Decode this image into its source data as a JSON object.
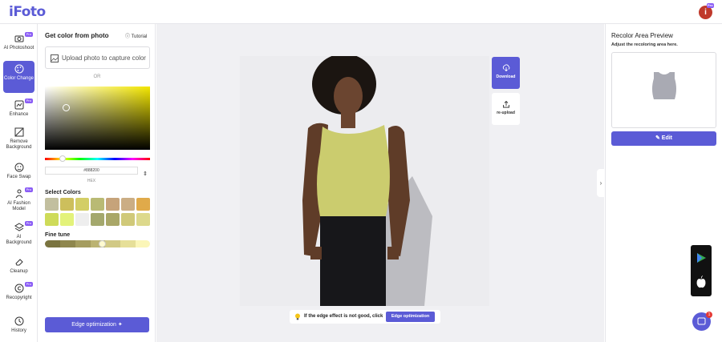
{
  "app": {
    "logo": "iFoto",
    "avatar_initial": "i",
    "avatar_badge": "Pro",
    "accent": "#5b5bd6"
  },
  "sidebar": {
    "items": [
      {
        "label": "AI Photoshoot",
        "icon": "camera-icon",
        "pro": "Pro"
      },
      {
        "label": "Color Change",
        "icon": "palette-icon",
        "active": true
      },
      {
        "label": "Enhance",
        "icon": "enhance-icon",
        "pro": "Pro"
      },
      {
        "label": "Remove Background",
        "icon": "remove-bg-icon"
      },
      {
        "label": "Face Swap",
        "icon": "face-swap-icon"
      },
      {
        "label": "AI Fashion Model",
        "icon": "person-icon",
        "pro": "Pro"
      },
      {
        "label": "AI Background",
        "icon": "layers-icon",
        "pro": "Pro"
      },
      {
        "label": "Cleanup",
        "icon": "eraser-icon"
      },
      {
        "label": "Recopyright",
        "icon": "copyright-icon",
        "pro": "Pro"
      },
      {
        "label": "History",
        "icon": "clock-icon"
      }
    ]
  },
  "panel": {
    "title": "Get color from photo",
    "tutorial": "Tutorial",
    "upload_label": "Upload photo to capture color",
    "or": "OR",
    "hex_value": "#888200",
    "hex_label": "HEX",
    "select_colors_title": "Select Colors",
    "swatches": [
      "#c2bf9f",
      "#cdbf5c",
      "#d3ce66",
      "#b9ba74",
      "#c6a37a",
      "#cbad84",
      "#e0aa4a",
      "#cedb59",
      "#e3f27a",
      "#eeeeee",
      "#a4a86d",
      "#a9a768",
      "#d0c979",
      "#ddd98c"
    ],
    "fine_tune_title": "Fine tune",
    "fine_tune_colors": [
      "#7a7440",
      "#8f874e",
      "#a59d60",
      "#bbb372",
      "#d1c985",
      "#e6df98",
      "#fbf6b8"
    ],
    "edge_button": "Edge optimization"
  },
  "canvas": {
    "download_label": "Download",
    "reupload_label": "re-upload",
    "hint_text": "If the edge effect is not good, click",
    "hint_button": "Edge optimization",
    "garment_color": "#cbcc6e"
  },
  "right_panel": {
    "title": "Recolor Area Preview",
    "subtitle": "Adjust the recoloring area here.",
    "edit_button": "Edit"
  },
  "chat": {
    "badge": "1"
  }
}
